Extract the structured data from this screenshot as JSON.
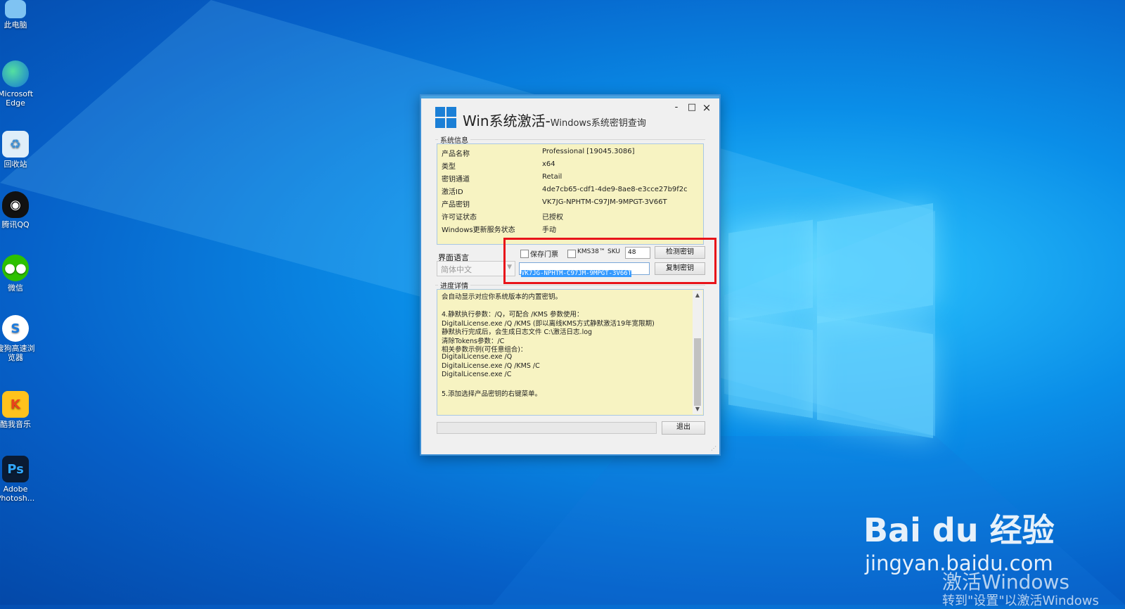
{
  "desktop": {
    "icons": [
      {
        "label": "此电脑",
        "icon": "computer-icon"
      },
      {
        "label": "Microsoft Edge",
        "icon": "edge-icon"
      },
      {
        "label": "回收站",
        "icon": "recycle-bin-icon"
      },
      {
        "label": "腾讯QQ",
        "icon": "qq-icon"
      },
      {
        "label": "微信",
        "icon": "wechat-icon"
      },
      {
        "label": "搜狗高速浏览器",
        "icon": "sogou-browser-icon"
      },
      {
        "label": "酷我音乐",
        "icon": "kuwo-music-icon"
      },
      {
        "label": "Adobe Photosh...",
        "icon": "photoshop-icon"
      }
    ]
  },
  "window": {
    "title_main": "Win系统激活-",
    "title_sub": "Windows系统密钥查询",
    "controls": {
      "minimize": "-",
      "maximize": "□",
      "close": "×"
    },
    "sysinfo": {
      "group_label": "系统信息",
      "rows": [
        {
          "key": "产品名称",
          "value": "Professional [19045.3086]"
        },
        {
          "key": "类型",
          "value": "x64"
        },
        {
          "key": "密钥通道",
          "value": "Retail"
        },
        {
          "key": "激活ID",
          "value": "4de7cb65-cdf1-4de9-8ae8-e3cce27b9f2c"
        },
        {
          "key": "产品密钥",
          "value": "VK7JG-NPHTM-C97JM-9MPGT-3V66T"
        },
        {
          "key": "许可证状态",
          "value": "已授权"
        },
        {
          "key": "Windows更新服务状态",
          "value": "手动"
        }
      ]
    },
    "language": {
      "label": "界面语言",
      "selected": "简体中文"
    },
    "options": {
      "keep_ticket_label": "保存门票",
      "keep_ticket_checked": false,
      "kms38_label": "KMS38™",
      "kms38_checked": false,
      "sku_label": "SKU",
      "sku_value": "48",
      "check_key_button": "检测密钥",
      "copy_key_button": "复制密钥",
      "key_value": "VK7JG-NPHTM-C97JM-9MPGT-3V66T"
    },
    "log": {
      "group_label": "进度详情",
      "lines": [
        "会自动显示对应你系统版本的内置密钥。",
        "",
        "4.静默执行参数：/Q，可配合 /KMS 参数使用：",
        "DigitalLicense.exe /Q /KMS (即以离线KMS方式静默激活19年宽限期)",
        "静默执行完成后，会生成日志文件 C:\\激活日志.log",
        "清除Tokens参数：/C",
        "相关参数示例(可任意组合)：",
        "DigitalLicense.exe /Q",
        "DigitalLicense.exe /Q /KMS /C",
        "DigitalLicense.exe /C",
        "",
        "5.添加选择产品密钥的右键菜单。"
      ]
    },
    "exit_button": "退出"
  },
  "watermark": {
    "brand": "Bai du 经验",
    "url": "jingyan.baidu.com",
    "activate_line1": "激活Windows",
    "activate_line2": "转到\"设置\"以激活Windows"
  }
}
